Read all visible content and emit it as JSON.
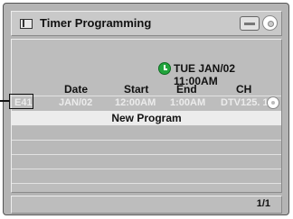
{
  "window": {
    "title": "Timer Programming",
    "icons": {
      "window": "window-icon",
      "media": "media-card-icon",
      "disc": "disc-icon"
    }
  },
  "clock": {
    "icon": "clock-icon",
    "datetime": "TUE JAN/02 11:00AM"
  },
  "table": {
    "headers": {
      "date": "Date",
      "start": "Start",
      "end": "End",
      "ch": "CH"
    },
    "program": {
      "mode": "E41",
      "date": "JAN/02",
      "start": "12:00AM",
      "end": "1:00AM",
      "ch": "DTV125. 1"
    },
    "new_program_label": "New Program"
  },
  "footer": {
    "page": "1/1"
  },
  "colors": {
    "screen_bg": "#b4b4b4",
    "clock_green": "#22a53d",
    "highlight_row": "#ececec"
  }
}
